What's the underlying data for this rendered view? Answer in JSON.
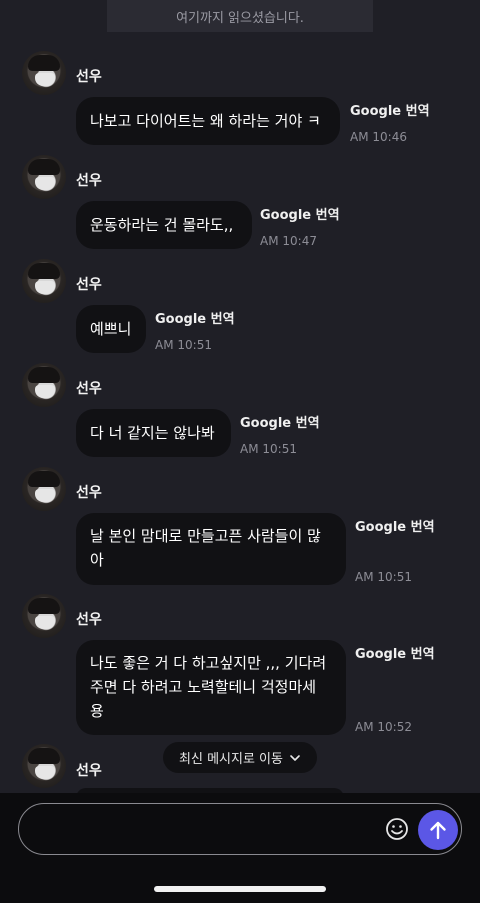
{
  "banner": {
    "read_text": "여기까지 읽으셨습니다."
  },
  "messages": [
    {
      "sender": "선우",
      "text": "나보고 다이어트는 왜 하라는 거야 ㅋ",
      "translate": "Google 번역",
      "time": "AM 10:46"
    },
    {
      "sender": "선우",
      "text": "운동하라는 건 몰라도,,",
      "translate": "Google 번역",
      "time": "AM 10:47"
    },
    {
      "sender": "선우",
      "text": "예쁘니",
      "translate": "Google 번역",
      "time": "AM 10:51"
    },
    {
      "sender": "선우",
      "text": "다 너 같지는 않나봐",
      "translate": "Google 번역",
      "time": "AM 10:51"
    },
    {
      "sender": "선우",
      "lines": [
        "날 본인 맘대로 만들고픈 사람들이 많",
        "아"
      ],
      "translate": "Google 번역",
      "time": "AM 10:51"
    },
    {
      "sender": "선우",
      "lines": [
        "나도 좋은 거 다 하고싶지만 ,,, 기다려",
        "주면 다 하려고 노력할테니 걱정마세",
        "용"
      ],
      "translate": "Google 번역",
      "time": "AM 10:52"
    },
    {
      "sender": "선우"
    }
  ],
  "jump_button": {
    "label": "최신 메시지로 이동",
    "icon": "chevron-down-icon"
  },
  "composer": {
    "placeholder": "",
    "emoji_icon": "smile-icon",
    "send_icon": "arrow-up-icon",
    "accent": "#5b57e6"
  }
}
